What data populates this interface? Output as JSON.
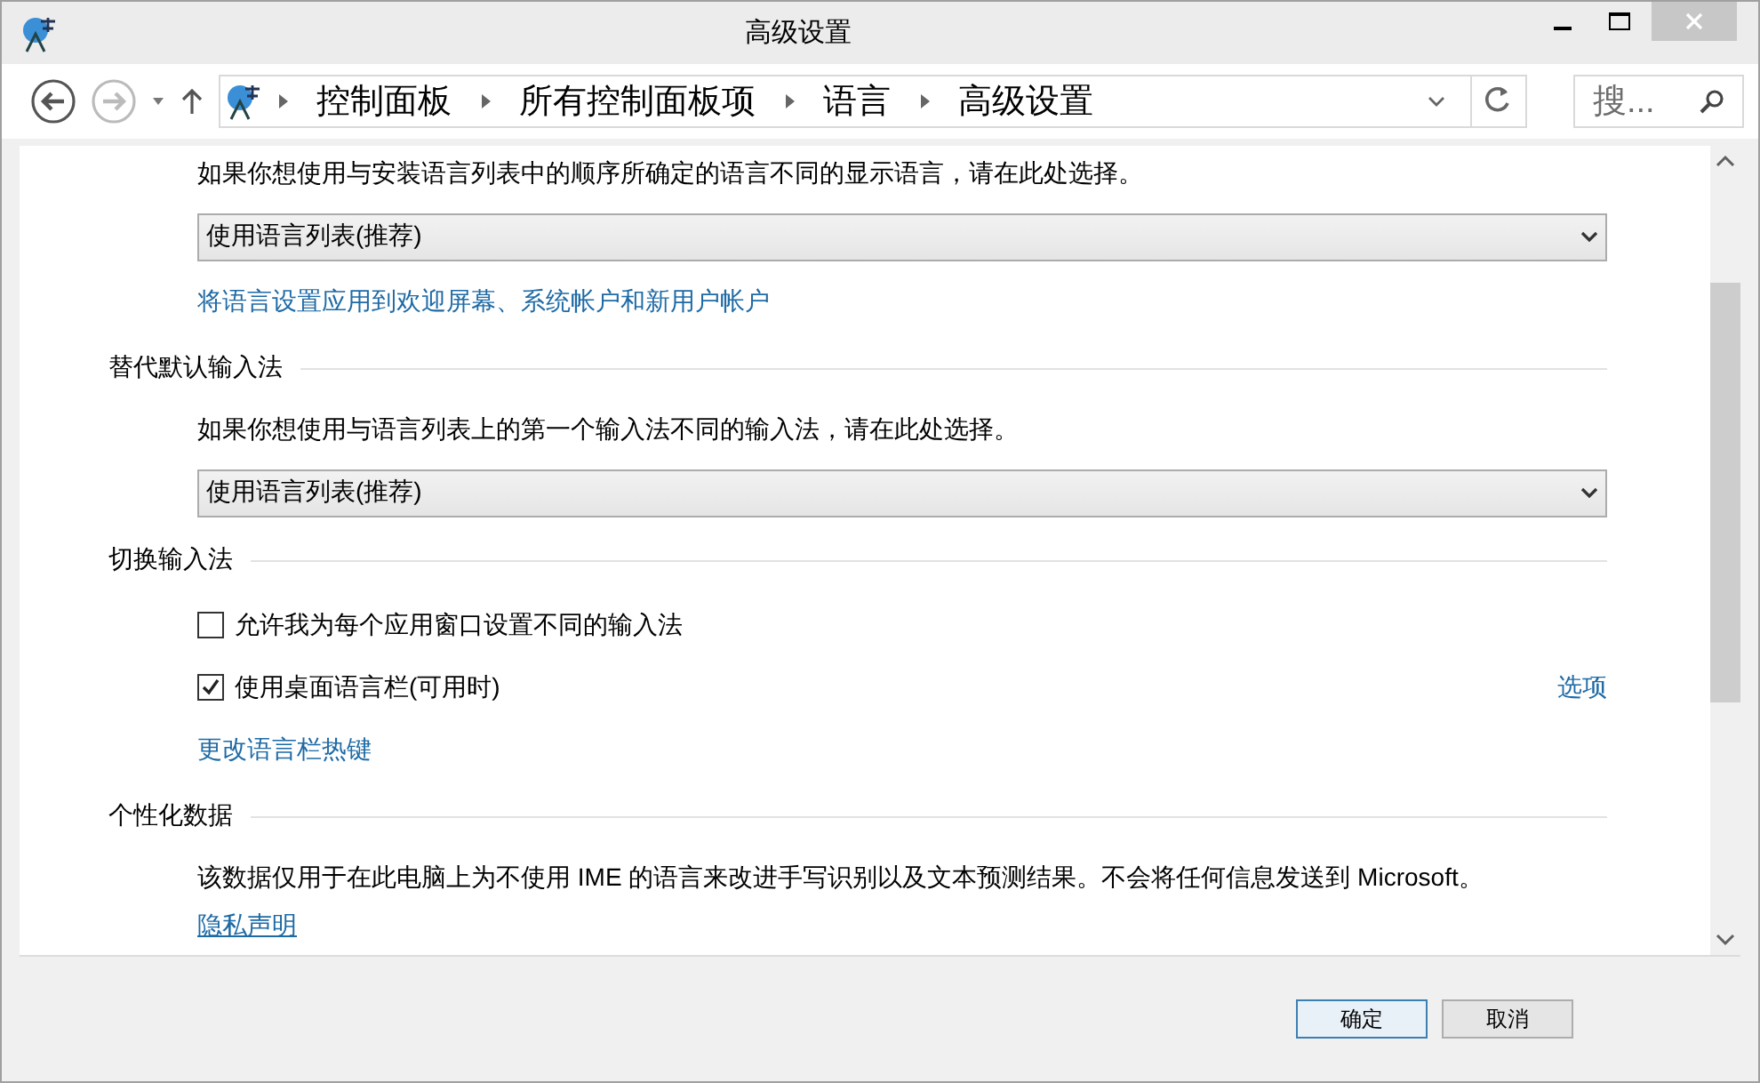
{
  "window": {
    "title": "高级设置"
  },
  "nav": {
    "breadcrumb": [
      "控制面板",
      "所有控制面板项",
      "语言",
      "高级设置"
    ],
    "search": {
      "placeholder": "搜..."
    }
  },
  "content": [
    {
      "kind": "description",
      "text": "如果你想使用与安装语言列表中的顺序所确定的语言不同的显示语言，请在此处选择。"
    },
    {
      "kind": "dropdown",
      "value": "使用语言列表(推荐)"
    },
    {
      "kind": "link",
      "text": "将语言设置应用到欢迎屏幕、系统帐户和新用户帐户",
      "underline": false
    },
    {
      "kind": "heading",
      "text": "替代默认输入法"
    },
    {
      "kind": "description",
      "text": "如果你想使用与语言列表上的第一个输入法不同的输入法，请在此处选择。"
    },
    {
      "kind": "dropdown",
      "value": "使用语言列表(推荐)"
    },
    {
      "kind": "heading",
      "text": "切换输入法"
    },
    {
      "kind": "checkbox",
      "label": "允许我为每个应用窗口设置不同的输入法",
      "checked": false
    },
    {
      "kind": "checkbox",
      "label": "使用桌面语言栏(可用时)",
      "checked": true,
      "side_link": "选项"
    },
    {
      "kind": "link",
      "text": "更改语言栏热键",
      "underline": false
    },
    {
      "kind": "heading",
      "text": "个性化数据"
    },
    {
      "kind": "description",
      "text": "该数据仅用于在此电脑上为不使用 IME 的语言来改进手写识别以及文本预测结果。不会将任何信息发送到 Microsoft。"
    },
    {
      "kind": "link",
      "text": "隐私声明",
      "underline": true
    }
  ],
  "buttons": [
    {
      "label": "确定",
      "default": true
    },
    {
      "label": "取消",
      "default": false
    }
  ]
}
